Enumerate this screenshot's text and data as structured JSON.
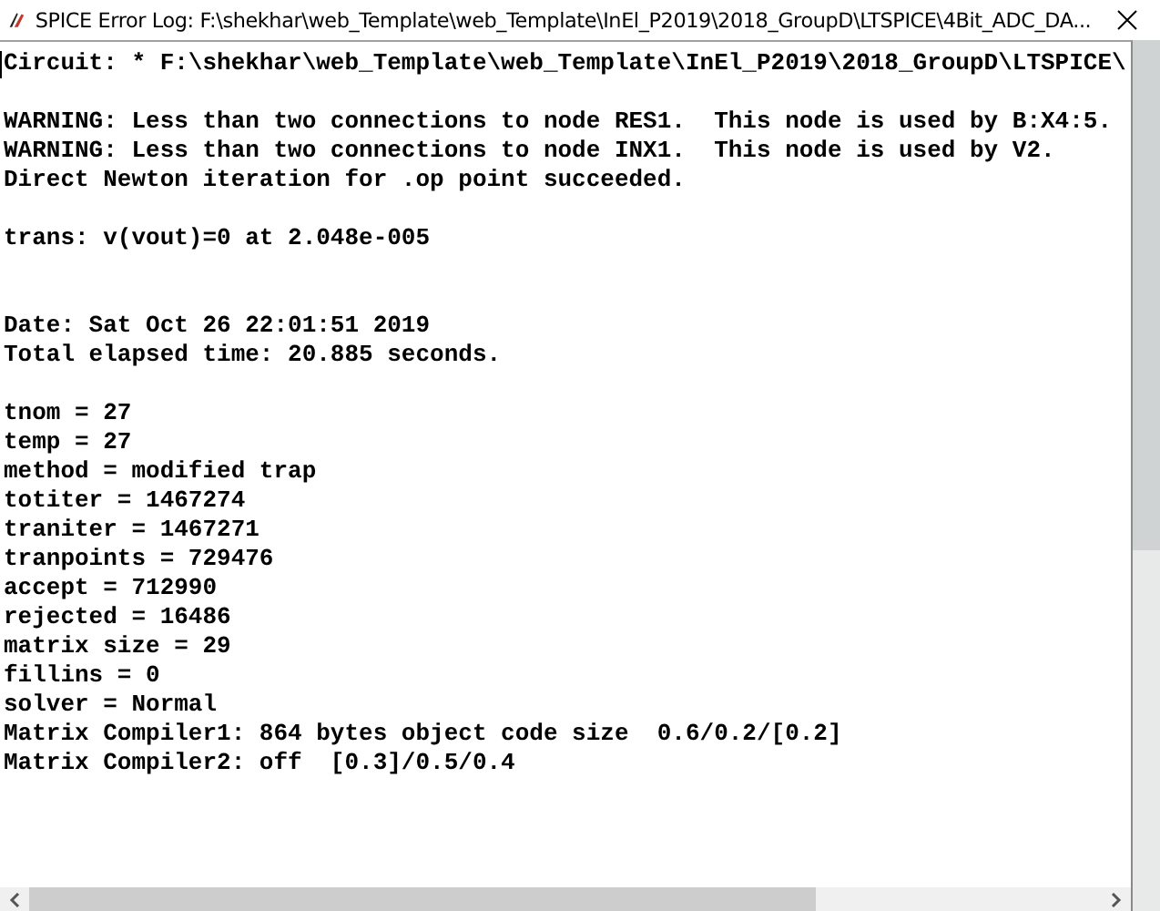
{
  "window": {
    "title": "SPICE Error Log: F:\\shekhar\\web_Template\\web_Template\\InEl_P2019\\2018_GroupD\\LTSPICE\\4Bit_ADC_DA..."
  },
  "lines": [
    {
      "kind": "text",
      "text": "Circuit: * F:\\shekhar\\web_Template\\web_Template\\InEl_P2019\\2018_GroupD\\LTSPICE\\"
    },
    {
      "kind": "blank"
    },
    {
      "kind": "text",
      "text": "WARNING: Less than two connections to node RES1.  This node is used by B:X4:5."
    },
    {
      "kind": "text",
      "text": "WARNING: Less than two connections to node INX1.  This node is used by V2."
    },
    {
      "kind": "text",
      "text": "Direct Newton iteration for .op point succeeded."
    },
    {
      "kind": "blank"
    },
    {
      "kind": "text",
      "text": "trans: v(vout)=0 at 2.048e-005"
    },
    {
      "kind": "blank"
    },
    {
      "kind": "blank"
    },
    {
      "kind": "text",
      "text": "Date: Sat Oct 26 22:01:51 2019"
    },
    {
      "kind": "text",
      "text": "Total elapsed time: 20.885 seconds."
    },
    {
      "kind": "blank"
    },
    {
      "kind": "text",
      "text": "tnom = 27"
    },
    {
      "kind": "text",
      "text": "temp = 27"
    },
    {
      "kind": "text",
      "text": "method = modified trap"
    },
    {
      "kind": "text",
      "text": "totiter = 1467274"
    },
    {
      "kind": "text",
      "text": "traniter = 1467271"
    },
    {
      "kind": "text",
      "text": "tranpoints = 729476"
    },
    {
      "kind": "text",
      "text": "accept = 712990"
    },
    {
      "kind": "text",
      "text": "rejected = 16486"
    },
    {
      "kind": "text",
      "text": "matrix size = 29"
    },
    {
      "kind": "text",
      "text": "fillins = 0"
    },
    {
      "kind": "text",
      "text": "solver = Normal"
    },
    {
      "kind": "text",
      "text": "Matrix Compiler1: 864 bytes object code size  0.6/0.2/[0.2]"
    },
    {
      "kind": "text",
      "text": "Matrix Compiler2: off  [0.3]/0.5/0.4"
    }
  ]
}
